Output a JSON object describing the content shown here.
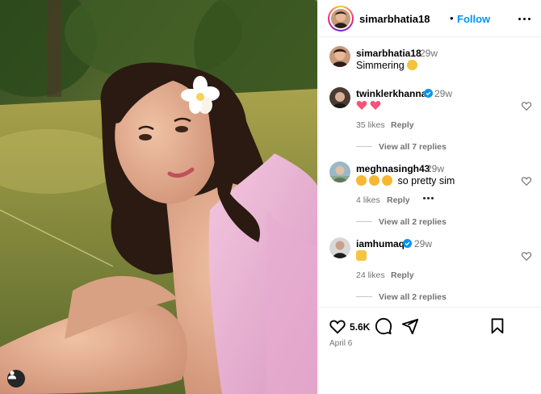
{
  "post": {
    "username": "simarbhatia18",
    "separator": "•",
    "follow_label": "Follow"
  },
  "caption": {
    "username": "simarbhatia18",
    "time": "29w",
    "text": "Simmering"
  },
  "comments": [
    {
      "username": "twinklerkhanna",
      "verified": true,
      "time": "29w",
      "text": "",
      "emojis": [
        "pink-heart",
        "pink-heart"
      ],
      "likes": "35 likes",
      "reply_label": "Reply",
      "view_replies": "View all 7 replies"
    },
    {
      "username": "meghnasingh43",
      "verified": false,
      "time": "29w",
      "text": "so pretty sim",
      "emojis": [
        "heart-eyes",
        "heart-eyes",
        "heart-eyes"
      ],
      "likes": "4 likes",
      "reply_label": "Reply",
      "view_replies": "View all 2 replies"
    },
    {
      "username": "iamhumaq",
      "verified": true,
      "time": "29w",
      "text": "",
      "emojis": [
        "raising-hands"
      ],
      "likes": "24 likes",
      "reply_label": "Reply",
      "view_replies": "View all 2 replies"
    }
  ],
  "actions": {
    "like_count": "5.6K",
    "date": "April 6"
  },
  "colors": {
    "link_blue": "#0095f6",
    "muted_gray": "#737373",
    "border": "#efefef"
  },
  "icons": {
    "more": "more-horizontal-icon",
    "like": "heart-icon",
    "comment": "comment-icon",
    "share": "share-icon",
    "save": "bookmark-icon",
    "tag": "user-tag-icon"
  }
}
